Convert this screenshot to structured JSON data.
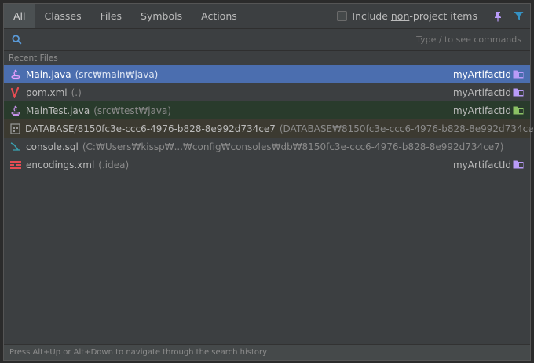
{
  "tabs": [
    {
      "label": "All",
      "active": true
    },
    {
      "label": "Classes",
      "active": false
    },
    {
      "label": "Files",
      "active": false
    },
    {
      "label": "Symbols",
      "active": false
    },
    {
      "label": "Actions",
      "active": false
    }
  ],
  "include_nonproject": {
    "prefix": "Include ",
    "underlined": "non",
    "suffix": "-project items",
    "checked": false
  },
  "search": {
    "value": "",
    "hint": "Type / to see commands"
  },
  "section_title": "Recent Files",
  "items": [
    {
      "icon": "java-file-icon",
      "name": "Main.java",
      "location": "(src₩main₩java)",
      "module": "myArtifactId",
      "module_icon": "module-folder-icon",
      "state": "selected"
    },
    {
      "icon": "maven-file-icon",
      "name": "pom.xml",
      "location": "(.)",
      "module": "myArtifactId",
      "module_icon": "module-folder-icon",
      "state": "normal"
    },
    {
      "icon": "java-file-icon",
      "name": "MainTest.java",
      "location": "(src₩test₩java)",
      "module": "myArtifactId",
      "module_icon": "test-folder-icon",
      "state": "test"
    },
    {
      "icon": "database-icon",
      "name": "DATABASE/8150fc3e-ccc6-4976-b828-8e992d734ce7",
      "location": "(DATABASE₩8150fc3e-ccc6-4976-b828-8e992d734ce7)",
      "module": "",
      "module_icon": "",
      "state": "db"
    },
    {
      "icon": "sql-console-icon",
      "name": "console.sql",
      "location": "(C:₩Users₩kissp₩...₩config₩consoles₩db₩8150fc3e-ccc6-4976-b828-8e992d734ce7)",
      "module": "",
      "module_icon": "",
      "state": "normal"
    },
    {
      "icon": "xml-config-icon",
      "name": "encodings.xml",
      "location": "(.idea)",
      "module": "myArtifactId",
      "module_icon": "module-folder-icon",
      "state": "normal"
    }
  ],
  "footer": "Press Alt+Up or Alt+Down to navigate through the search history",
  "colors": {
    "selected": "#4b6eaf",
    "test_row": "#293b2c",
    "db_row": "#3c3a31",
    "accent": "#3592c4"
  }
}
